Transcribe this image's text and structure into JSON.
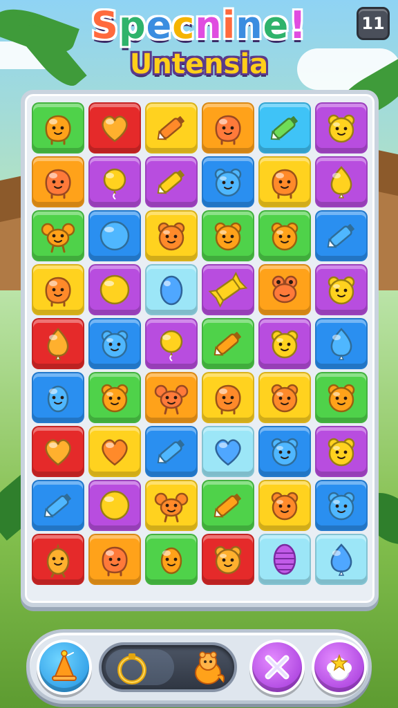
{
  "title": {
    "main": "Specnine!",
    "main_display": [
      "S",
      "p",
      "e",
      "c",
      "n",
      "i",
      "n",
      "e",
      "!"
    ],
    "sub": "Untensia"
  },
  "level_badge": "11",
  "colors": {
    "green": "#4fd24a",
    "red": "#e52a2a",
    "yellow": "#ffd21f",
    "orange": "#ffa21a",
    "sky": "#3fc3f7",
    "purple": "#b84ddf",
    "blue": "#2a8ff0",
    "cyan": "#9ce6f7"
  },
  "board": {
    "rows": [
      [
        {
          "c": "green",
          "i": "blob-face"
        },
        {
          "c": "red",
          "i": "heart"
        },
        {
          "c": "yellow",
          "i": "crayon"
        },
        {
          "c": "orange",
          "i": "blob-face"
        },
        {
          "c": "sky",
          "i": "crayon"
        },
        {
          "c": "purple",
          "i": "bear-face"
        }
      ],
      [
        {
          "c": "orange",
          "i": "blob-face"
        },
        {
          "c": "purple",
          "i": "balloon"
        },
        {
          "c": "purple",
          "i": "crayon"
        },
        {
          "c": "blue",
          "i": "bear-face"
        },
        {
          "c": "yellow",
          "i": "blob-face"
        },
        {
          "c": "purple",
          "i": "drop"
        }
      ],
      [
        {
          "c": "green",
          "i": "crab"
        },
        {
          "c": "blue",
          "i": "ball"
        },
        {
          "c": "yellow",
          "i": "bear-face"
        },
        {
          "c": "green",
          "i": "bear-face"
        },
        {
          "c": "green",
          "i": "bear-face"
        },
        {
          "c": "blue",
          "i": "crayon"
        }
      ],
      [
        {
          "c": "yellow",
          "i": "blob-face"
        },
        {
          "c": "purple",
          "i": "ball"
        },
        {
          "c": "cyan",
          "i": "egg"
        },
        {
          "c": "purple",
          "i": "candy"
        },
        {
          "c": "orange",
          "i": "frog"
        },
        {
          "c": "purple",
          "i": "bear-face"
        }
      ],
      [
        {
          "c": "red",
          "i": "drop"
        },
        {
          "c": "blue",
          "i": "bear-face"
        },
        {
          "c": "purple",
          "i": "balloon"
        },
        {
          "c": "green",
          "i": "crayon"
        },
        {
          "c": "purple",
          "i": "bear-face"
        },
        {
          "c": "blue",
          "i": "drop"
        }
      ],
      [
        {
          "c": "blue",
          "i": "egg-face"
        },
        {
          "c": "green",
          "i": "bear-face"
        },
        {
          "c": "orange",
          "i": "crab"
        },
        {
          "c": "yellow",
          "i": "blob-face"
        },
        {
          "c": "yellow",
          "i": "bear-face"
        },
        {
          "c": "green",
          "i": "bear-face"
        }
      ],
      [
        {
          "c": "red",
          "i": "heart"
        },
        {
          "c": "yellow",
          "i": "heart"
        },
        {
          "c": "blue",
          "i": "crayon"
        },
        {
          "c": "cyan",
          "i": "heart"
        },
        {
          "c": "blue",
          "i": "bear-face"
        },
        {
          "c": "purple",
          "i": "bear-face"
        }
      ],
      [
        {
          "c": "blue",
          "i": "crayon"
        },
        {
          "c": "purple",
          "i": "ball"
        },
        {
          "c": "yellow",
          "i": "crab"
        },
        {
          "c": "green",
          "i": "crayon"
        },
        {
          "c": "yellow",
          "i": "bear-face"
        },
        {
          "c": "blue",
          "i": "bear-face"
        }
      ],
      [
        {
          "c": "red",
          "i": "chick"
        },
        {
          "c": "orange",
          "i": "blob-face"
        },
        {
          "c": "green",
          "i": "egg-face"
        },
        {
          "c": "red",
          "i": "bear-face"
        },
        {
          "c": "cyan",
          "i": "cocoon"
        },
        {
          "c": "cyan",
          "i": "drop"
        }
      ]
    ]
  },
  "bottom_bar": {
    "left_button_icon": "bell-icon",
    "progress_icon_left": "ring-icon",
    "progress_icon_right": "critter-icon",
    "progress": 0.55,
    "close_button_icon": "close-icon",
    "boost_button_icon": "star-burst-icon"
  }
}
